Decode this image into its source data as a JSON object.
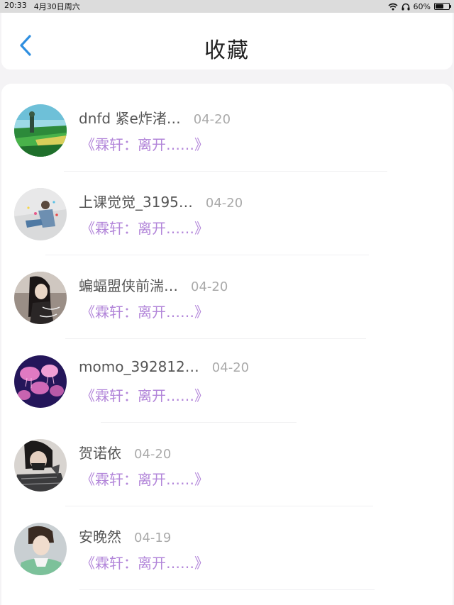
{
  "status_bar": {
    "time": "20:33",
    "date": "4月30日周六",
    "battery_text": "60%",
    "battery_level": 0.6
  },
  "nav": {
    "title": "收藏"
  },
  "items": [
    {
      "name": "dnfd 紧e炸渚…",
      "date": "04-20",
      "title": "《霖轩：离开……》"
    },
    {
      "name": "上课觉觉_3195…",
      "date": "04-20",
      "title": "《霖轩：离开……》"
    },
    {
      "name": "蝙蝠盟侠前湍…",
      "date": "04-20",
      "title": "《霖轩：离开……》"
    },
    {
      "name": "momo_392812…",
      "date": "04-20",
      "title": "《霖轩：离开……》"
    },
    {
      "name": "贺诺依",
      "date": "04-20",
      "title": "《霖轩：离开……》"
    },
    {
      "name": "安晚然",
      "date": "04-19",
      "title": "《霖轩：离开……》"
    }
  ]
}
